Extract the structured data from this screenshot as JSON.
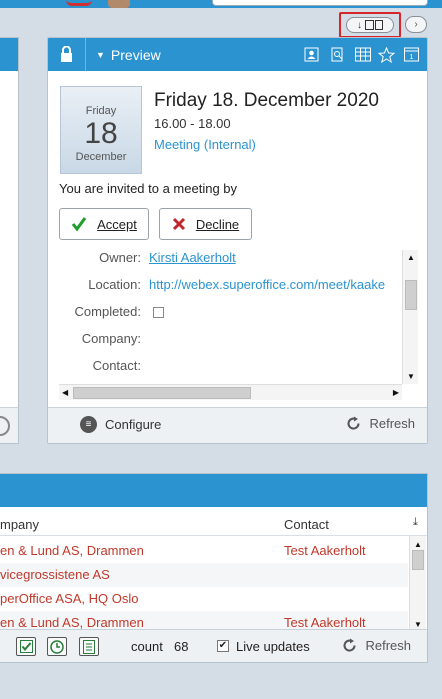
{
  "preview": {
    "title": "Preview",
    "date": {
      "weekday": "Friday",
      "day": "18",
      "month": "December"
    },
    "appointment": {
      "title": "Friday 18. December 2020",
      "time": "16.00 - 18.00",
      "type": "Meeting (Internal)"
    },
    "invite_text": "You are invited to a meeting by",
    "accept_label": "Accept",
    "decline_label": "Decline",
    "details": [
      {
        "key": "Owner:",
        "value": "Kirsti Aakerholt"
      },
      {
        "key": "Location:",
        "value": "http://webex.superoffice.com/meet/kaake"
      },
      {
        "key": "Completed:",
        "value": ""
      },
      {
        "key": "Company:",
        "value": ""
      },
      {
        "key": "Contact:",
        "value": ""
      }
    ],
    "configure_label": "Configure",
    "refresh_label": "Refresh"
  },
  "list": {
    "columns": {
      "company": "mpany",
      "contact": "Contact"
    },
    "rows": [
      {
        "company": "en & Lund AS, Drammen",
        "contact": "Test Aakerholt"
      },
      {
        "company": "vicegrossistene AS",
        "contact": ""
      },
      {
        "company": "perOffice ASA, HQ Oslo",
        "contact": ""
      },
      {
        "company": "en & Lund AS, Drammen",
        "contact": "Test Aakerholt"
      }
    ],
    "count_label": "count",
    "count_value": "68",
    "live_updates_label": "Live updates",
    "refresh_label": "Refresh"
  },
  "colors": {
    "accent": "#2b93d0",
    "highlight": "#d6252b",
    "link": "#2b93d0",
    "list_text": "#c0392b"
  }
}
